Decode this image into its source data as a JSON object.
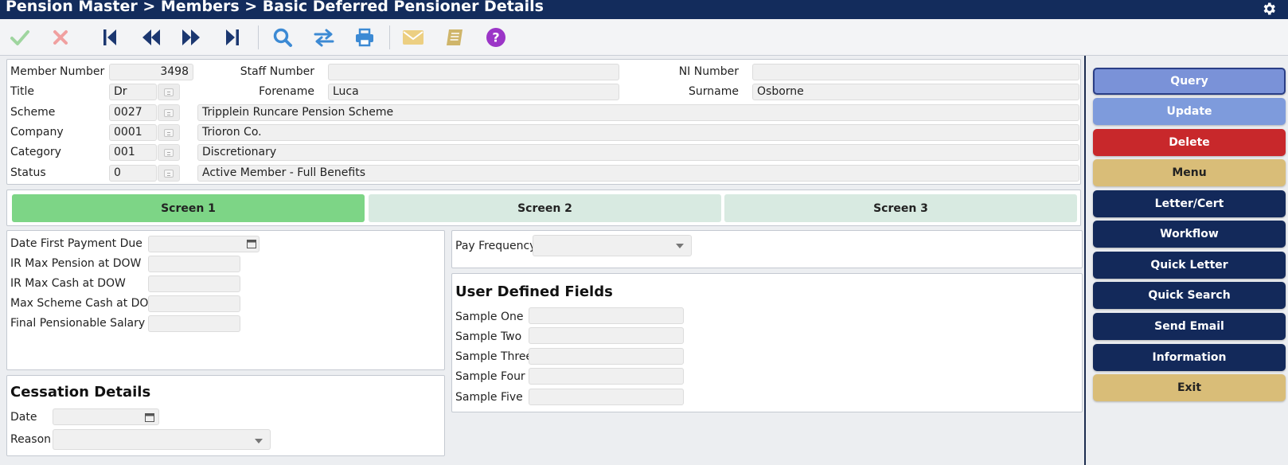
{
  "window": {
    "title": "Pension Master > Members > Basic Deferred Pensioner Details"
  },
  "toolbar": {
    "icons": [
      "check-icon",
      "cancel-icon",
      "first-record-icon",
      "previous-record-icon",
      "next-record-icon",
      "last-record-icon",
      "search-icon",
      "swap-icon",
      "print-icon",
      "email-icon",
      "notes-icon",
      "help-icon"
    ],
    "colors": {
      "check": "#9fd59f",
      "cancel": "#f0a0a0",
      "nav": "#1b3770",
      "blue": "#3c8ad4",
      "print": "#3c8ad4",
      "mail": "#eccf82",
      "book": "#cfb56a",
      "help": "#9b35c7"
    }
  },
  "member": {
    "member_number_label": "Member Number",
    "member_number": "3498",
    "staff_number_label": "Staff Number",
    "staff_number": "",
    "ni_number_label": "NI Number",
    "ni_number": "",
    "title_label": "Title",
    "title_value": "Dr",
    "forename_label": "Forename",
    "forename": "Luca",
    "surname_label": "Surname",
    "surname": "Osborne",
    "scheme_label": "Scheme",
    "scheme_code": "0027",
    "scheme_name": "Tripplein Runcare Pension Scheme",
    "company_label": "Company",
    "company_code": "0001",
    "company_name": "Trioron Co.",
    "category_label": "Category",
    "category_code": "001",
    "category_name": "Discretionary",
    "status_label": "Status",
    "status_code": "0",
    "status_name": "Active Member - Full Benefits"
  },
  "tabs": [
    {
      "label": "Screen 1",
      "active": true
    },
    {
      "label": "Screen 2",
      "active": false
    },
    {
      "label": "Screen 3",
      "active": false
    }
  ],
  "payment": {
    "date_first_payment_due_label": "Date First Payment Due",
    "date_first_payment_due": "",
    "ir_max_pension_label": "IR Max Pension at DOW",
    "ir_max_pension": "",
    "ir_max_cash_label": "IR Max Cash at DOW",
    "ir_max_cash": "",
    "max_scheme_cash_label": "Max Scheme Cash at DOW",
    "max_scheme_cash": "",
    "final_pensionable_salary_label": "Final Pensionable Salary",
    "final_pensionable_salary": ""
  },
  "pay_frequency": {
    "label": "Pay Frequency",
    "value": ""
  },
  "cessation": {
    "heading": "Cessation Details",
    "date_label": "Date",
    "date": "",
    "reason_label": "Reason",
    "reason": ""
  },
  "user_defined": {
    "heading": "User Defined Fields",
    "fields": [
      {
        "label": "Sample One",
        "value": ""
      },
      {
        "label": "Sample Two",
        "value": ""
      },
      {
        "label": "Sample Three",
        "value": ""
      },
      {
        "label": "Sample Four",
        "value": ""
      },
      {
        "label": "Sample Five",
        "value": ""
      }
    ]
  },
  "actions": [
    {
      "label": "Query",
      "style": "query"
    },
    {
      "label": "Update",
      "style": "update"
    },
    {
      "label": "Delete",
      "style": "delete"
    },
    {
      "label": "Menu",
      "style": "gold"
    },
    {
      "label": "Letter/Cert",
      "style": "navy"
    },
    {
      "label": "Workflow",
      "style": "navy"
    },
    {
      "label": "Quick Letter",
      "style": "navy"
    },
    {
      "label": "Quick Search",
      "style": "navy"
    },
    {
      "label": "Send Email",
      "style": "navy"
    },
    {
      "label": "Information",
      "style": "navy"
    },
    {
      "label": "Exit",
      "style": "gold"
    }
  ]
}
